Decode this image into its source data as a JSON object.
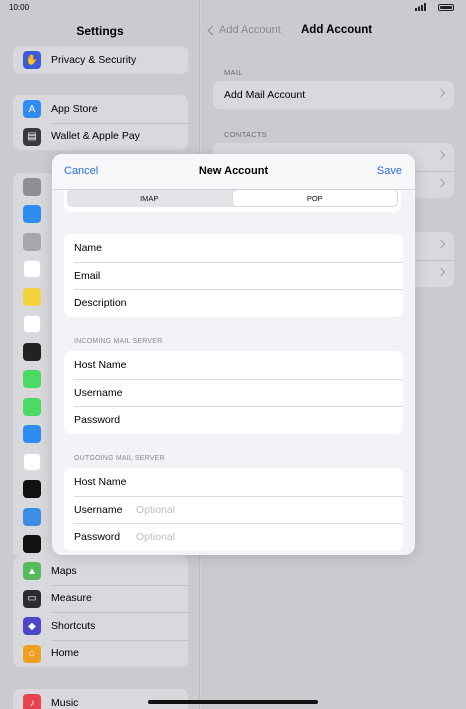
{
  "status_bar": {
    "time": "10:00"
  },
  "sidebar": {
    "title": "Settings",
    "group1": [
      {
        "label": "Privacy & Security",
        "icon": "hand-icon",
        "color": "#3b5bd9"
      }
    ],
    "group2": [
      {
        "label": "App Store",
        "icon": "app-store-icon",
        "color": "#2f8cf0"
      },
      {
        "label": "Wallet & Apple Pay",
        "icon": "wallet-icon",
        "color": "#3a3a3c"
      }
    ],
    "group4": [
      {
        "label": "Maps",
        "icon": "maps-icon",
        "color": "#58b85c"
      },
      {
        "label": "Measure",
        "icon": "measure-icon",
        "color": "#2c2c2e"
      },
      {
        "label": "Shortcuts",
        "icon": "shortcuts-icon",
        "color": "#4b47c9"
      },
      {
        "label": "Home",
        "icon": "home-icon",
        "color": "#f0a020"
      }
    ],
    "group5": [
      {
        "label": "Music",
        "icon": "music-icon",
        "color": "#e9424f"
      }
    ]
  },
  "detail": {
    "back_label": "Add Account",
    "title": "Add Account",
    "mail_section": "MAIL",
    "mail_rows": [
      {
        "label": "Add Mail Account"
      }
    ],
    "contacts_section": "CONTACTS"
  },
  "modal": {
    "cancel_label": "Cancel",
    "title": "New Account",
    "save_label": "Save",
    "segments": [
      {
        "label": "IMAP",
        "active": false
      },
      {
        "label": "POP",
        "active": true
      }
    ],
    "account_fields": [
      {
        "label": "Name",
        "placeholder": ""
      },
      {
        "label": "Email",
        "placeholder": ""
      },
      {
        "label": "Description",
        "placeholder": ""
      }
    ],
    "incoming_section": "INCOMING MAIL SERVER",
    "incoming_fields": [
      {
        "label": "Host Name",
        "placeholder": ""
      },
      {
        "label": "Username",
        "placeholder": ""
      },
      {
        "label": "Password",
        "placeholder": ""
      }
    ],
    "outgoing_section": "OUTGOING MAIL SERVER",
    "outgoing_fields": [
      {
        "label": "Host Name",
        "placeholder": ""
      },
      {
        "label": "Username",
        "placeholder": "Optional"
      },
      {
        "label": "Password",
        "placeholder": "Optional"
      }
    ]
  }
}
